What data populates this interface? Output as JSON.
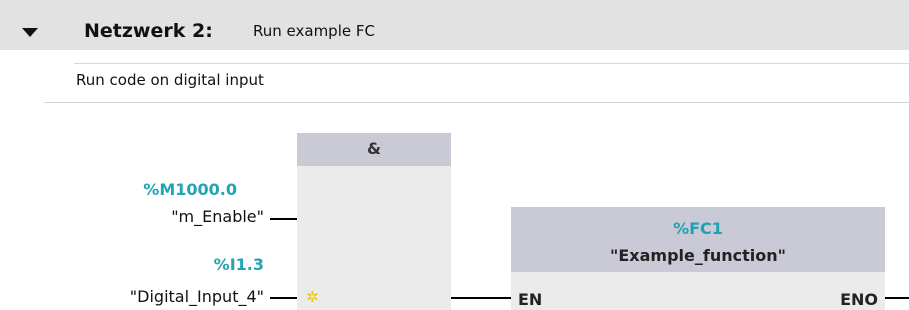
{
  "network": {
    "title": "Netzwerk 2:",
    "name": "Run example FC",
    "comment": "Run code on digital input"
  },
  "and_block": {
    "label": "&"
  },
  "operands": [
    {
      "address": "%M1000.0",
      "symbol": "\"m_Enable\""
    },
    {
      "address": "%I1.3",
      "symbol": "\"Digital_Input_4\""
    }
  ],
  "fc_block": {
    "address": "%FC1",
    "name": "\"Example_function\"",
    "en_label": "EN",
    "eno_label": "ENO"
  },
  "icons": {
    "collapse": "triangle-down",
    "insert_input": "asterisk-star"
  },
  "colors": {
    "header_bg": "#e2e2e2",
    "block_header": "#c9cad6",
    "block_body": "#ebebeb",
    "operand_address": "#22a4b4"
  }
}
